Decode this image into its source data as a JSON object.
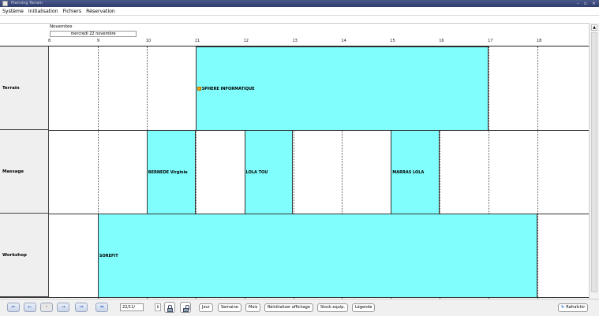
{
  "window": {
    "title": "Planning Terrain",
    "controls": [
      "–",
      "▫",
      "✕"
    ]
  },
  "menu": [
    "Système",
    "Initialisation",
    "Fichiers",
    "Réservation"
  ],
  "planner": {
    "month": "Novembre",
    "day": "mercredi 22 novembre",
    "hours": [
      "8",
      "9",
      "10",
      "11",
      "12",
      "13",
      "14",
      "15",
      "16",
      "17",
      "18"
    ],
    "rows": [
      {
        "name": "Terrain",
        "bookings": [
          {
            "label": "SPHERE INFORMATIQUE",
            "start": 11,
            "end": 17,
            "flag": true
          }
        ]
      },
      {
        "name": "Massage",
        "bookings": [
          {
            "label": "BERNEDE Virginie",
            "start": 10,
            "end": 11
          },
          {
            "label": "LOLA TOU",
            "start": 12,
            "end": 13
          },
          {
            "label": "MARRAS LOLA",
            "start": 15,
            "end": 16
          }
        ]
      },
      {
        "name": "Workshop",
        "bookings": [
          {
            "label": "SOREFIT",
            "start": 9,
            "end": 18
          }
        ]
      }
    ]
  },
  "toolbar": {
    "date_value": "22/11/",
    "spin": "⇕",
    "buttons": [
      "Jour",
      "Semaine",
      "Mois",
      "Réinitialiser affichage",
      "Stock equip.",
      "Légende"
    ],
    "refresh_icon": "↻",
    "refresh_label": "Rafraîchir"
  },
  "colors": {
    "booking": "#80fdfd",
    "flag": "#f2a600",
    "titlebar": "#2f3d6e"
  }
}
